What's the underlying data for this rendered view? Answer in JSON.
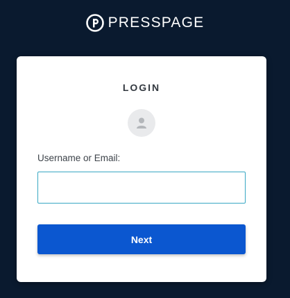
{
  "brand": {
    "logo_icon": "presspage-logo-icon",
    "name": "PRESSPAGE"
  },
  "login": {
    "title": "LOGIN",
    "avatar_icon": "user-icon",
    "username_label": "Username or Email:",
    "username_value": "",
    "username_placeholder": "",
    "next_label": "Next"
  },
  "colors": {
    "background": "#0a1a2f",
    "card": "#ffffff",
    "button": "#0b57d0",
    "input_border": "#37a7c3"
  }
}
